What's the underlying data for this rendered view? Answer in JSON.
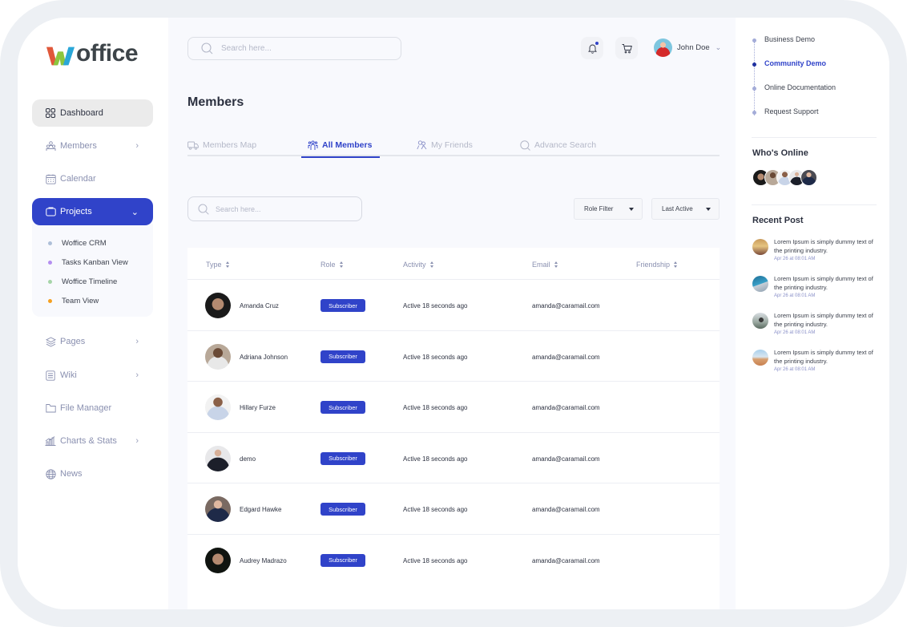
{
  "app": {
    "logo_text": "offi ce",
    "logo_rest": "office"
  },
  "sidebar": {
    "items": [
      {
        "label": "Dashboard",
        "icon": "grid-icon",
        "state": "highlight"
      },
      {
        "label": "Members",
        "icon": "people-icon",
        "has_chevron": true
      },
      {
        "label": "Calendar",
        "icon": "calendar-icon"
      },
      {
        "label": "Projects",
        "icon": "briefcase-icon",
        "state": "expanded",
        "has_chevron": true
      },
      {
        "label": "Pages",
        "icon": "layers-icon",
        "has_chevron": true
      },
      {
        "label": "Wiki",
        "icon": "document-list-icon",
        "has_chevron": true
      },
      {
        "label": "File Manager",
        "icon": "folder-icon"
      },
      {
        "label": "Charts & Stats",
        "icon": "bar-chart-icon",
        "has_chevron": true
      },
      {
        "label": "News",
        "icon": "globe-icon"
      }
    ],
    "projects_sub": [
      {
        "label": "Woffice CRM",
        "color": "#aebfd8"
      },
      {
        "label": "Tasks Kanban View",
        "color": "#b48ef0"
      },
      {
        "label": "Woffice Timeline",
        "color": "#a6d4a8"
      },
      {
        "label": "Team View",
        "color": "#f5a020"
      }
    ]
  },
  "header": {
    "search_placeholder": "Search here...",
    "notification_badge": true,
    "user_name": "John Doe"
  },
  "main": {
    "title": "Members",
    "tabs": [
      {
        "label": "Members Map",
        "icon": "truck-icon",
        "active": false
      },
      {
        "label": "All Members",
        "icon": "group-icon",
        "active": true
      },
      {
        "label": "My Friends",
        "icon": "friends-icon",
        "active": false
      },
      {
        "label": "Advance Search",
        "icon": "search-icon",
        "active": false
      }
    ],
    "search_placeholder": "Search here...",
    "filters": {
      "role": "Role Filter",
      "sort": "Last Active"
    },
    "table": {
      "columns": [
        "Type",
        "Role",
        "Activity",
        "Email",
        "Friendship"
      ],
      "rows": [
        {
          "name": "Amanda Cruz",
          "role": "Subscriber",
          "activity": "Active 18 seconds ago",
          "email": "amanda@caramail.com",
          "friendship": ""
        },
        {
          "name": "Adriana Johnson",
          "role": "Subscriber",
          "activity": "Active 18 seconds ago",
          "email": "amanda@caramail.com",
          "friendship": ""
        },
        {
          "name": "Hillary Furze",
          "role": "Subscriber",
          "activity": "Active 18 seconds ago",
          "email": "amanda@caramail.com",
          "friendship": ""
        },
        {
          "name": "demo",
          "role": "Subscriber",
          "activity": "Active 18 seconds ago",
          "email": "amanda@caramail.com",
          "friendship": ""
        },
        {
          "name": "Edgard Hawke",
          "role": "Subscriber",
          "activity": "Active 18 seconds ago",
          "email": "amanda@caramail.com",
          "friendship": ""
        },
        {
          "name": "Audrey Madrazo",
          "role": "Subscriber",
          "activity": "Active 18 seconds ago",
          "email": "amanda@caramail.com",
          "friendship": ""
        }
      ]
    }
  },
  "right_panel": {
    "links": [
      {
        "label": "Business Demo",
        "active": false
      },
      {
        "label": "Community Demo",
        "active": true
      },
      {
        "label": "Online Documentation",
        "active": false
      },
      {
        "label": "Request Support",
        "active": false
      }
    ],
    "whos_online_title": "Who's Online",
    "online_count": 5,
    "recent_post_title": "Recent Post",
    "posts": [
      {
        "text": "Lorem Ipsum is simply dummy text of the printing industry.",
        "date": "Apr 26 at 08:01 AM"
      },
      {
        "text": "Lorem Ipsum is simply dummy text of the printing industry.",
        "date": "Apr 26 at 08:01 AM"
      },
      {
        "text": "Lorem Ipsum is simply dummy text of the printing industry.",
        "date": "Apr 26 at 08:01 AM"
      },
      {
        "text": "Lorem Ipsum is simply dummy text of the printing industry.",
        "date": "Apr 26 at 08:01 AM"
      }
    ]
  },
  "colors": {
    "accent": "#3043c9",
    "frame": "#edf0f4",
    "main_bg": "#f8f9fd",
    "muted_text": "#8a90b0"
  }
}
